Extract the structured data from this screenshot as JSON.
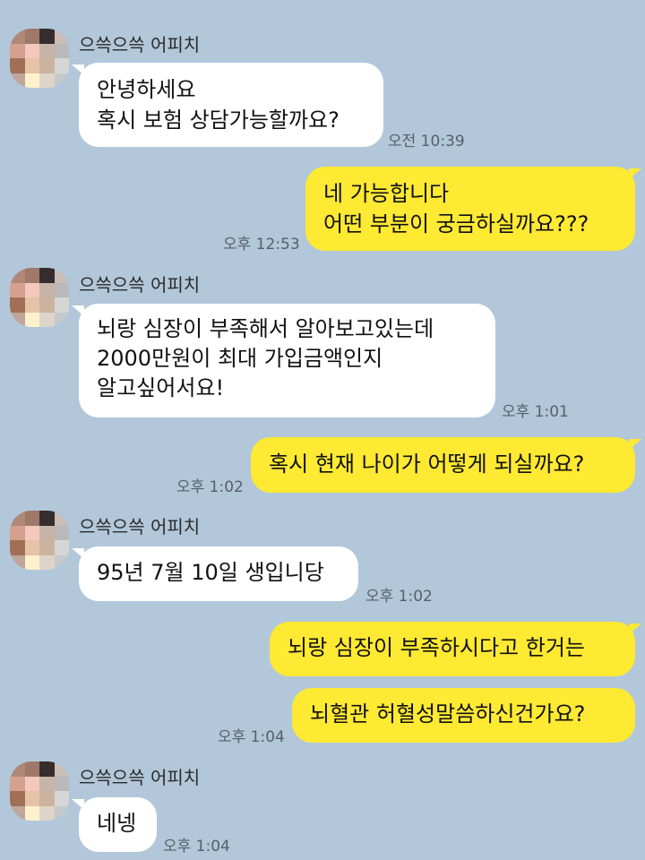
{
  "chat": {
    "sender_name": "으쓱으쓱 어피치",
    "messages": [
      {
        "dir": "in",
        "text": "안녕하세요\n혹시 보험 상담가능할까요?",
        "time": "오전 10:39"
      },
      {
        "dir": "out",
        "text": "네 가능합니다\n어떤 부분이 궁금하실까요???",
        "time": "오후 12:53"
      },
      {
        "dir": "in",
        "text": "뇌랑 심장이 부족해서 알아보고있는데\n2000만원이 최대 가입금액인지\n알고싶어서요!",
        "time": "오후 1:01"
      },
      {
        "dir": "out",
        "text": "혹시 현재 나이가 어떻게 되실까요?",
        "time": "오후 1:02"
      },
      {
        "dir": "in",
        "text": "95년 7월 10일 생입니당",
        "time": "오후 1:02"
      },
      {
        "dir": "out",
        "text": "뇌랑 심장이 부족하시다고 한거는",
        "time": ""
      },
      {
        "dir": "out",
        "text": "뇌혈관 허혈성말씀하신건가요?",
        "time": "오후 1:04"
      },
      {
        "dir": "in",
        "text": "네넹",
        "time": "오후 1:04"
      }
    ]
  },
  "colors": {
    "background": "#b2c7d9",
    "incoming_bubble": "#ffffff",
    "outgoing_bubble": "#fee933"
  },
  "avatar_pixels": [
    "#b08878",
    "#a0786a",
    "#352d2e",
    "#c9bdb6",
    "#d6a08e",
    "#f2c9bc",
    "#c7b4a8",
    "#b9b9b9",
    "#a06f56",
    "#e6c3a8",
    "#cdb39d",
    "#d6d6d6",
    "#bfa59a",
    "#fff1cc",
    "#ddd5c9",
    "#c6c9cc"
  ]
}
